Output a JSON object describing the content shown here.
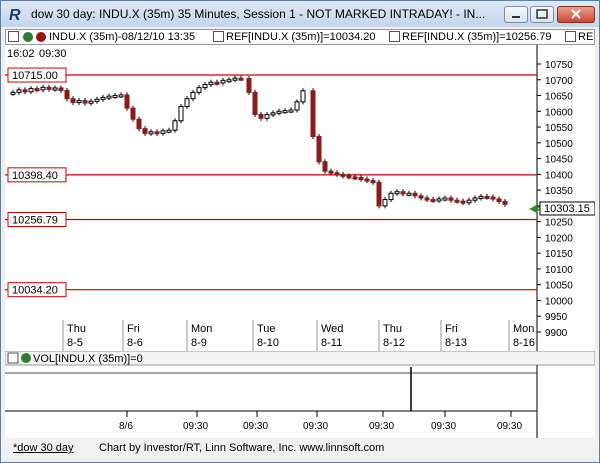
{
  "window": {
    "title": "dow 30 day: INDU.X (35m) 35 Minutes, Session 1 - NOT MARKED INTRADAY! - IN...",
    "minimize": "minimize",
    "maximize": "maximize",
    "close": "close"
  },
  "toolbar": {
    "main_study": "INDU.X (35m)-08/12/10 13:35",
    "ref1": "REF[INDU.X (35m)]=10034.20",
    "ref2": "REF[INDU.X (35m)]=10256.79",
    "ref3": "REF["
  },
  "chart": {
    "time_cursor": "16:02",
    "time_cursor2": "09:30",
    "price_marker": "10303.15",
    "ref_lines": [
      {
        "label": "10715.00",
        "value": 10715.0
      },
      {
        "label": "10398.40",
        "value": 10398.4
      },
      {
        "label": "10256.79",
        "value": 10256.79
      },
      {
        "label": "10034.20",
        "value": 10034.2
      }
    ],
    "y_ticks": [
      "10750",
      "10700",
      "10650",
      "10600",
      "10550",
      "10500",
      "10450",
      "10400",
      "10350",
      "10300",
      "10250",
      "10200",
      "10150",
      "10100",
      "10050",
      "10000",
      "9950",
      "9900"
    ],
    "day_labels": [
      {
        "dow": "Thu",
        "date": "8-5"
      },
      {
        "dow": "Fri",
        "date": "8-6"
      },
      {
        "dow": "Mon",
        "date": "8-9"
      },
      {
        "dow": "Tue",
        "date": "8-10"
      },
      {
        "dow": "Wed",
        "date": "8-11"
      },
      {
        "dow": "Thu",
        "date": "8-12"
      },
      {
        "dow": "Fri",
        "date": "8-13"
      },
      {
        "dow": "Mon",
        "date": "8-16"
      }
    ],
    "colors": {
      "ref_line": "#cc0000",
      "down_candle": "#8b1a1a",
      "up_candle": "#000000",
      "marker": "#2e8b2e"
    }
  },
  "volume": {
    "label": "VOL[INDU.X (35m)]=0",
    "x_labels": [
      "8/6",
      "09:30",
      "09:30",
      "09:30",
      "09:30",
      "09:30",
      "09:30"
    ]
  },
  "status": {
    "tab": "*dow 30 day",
    "credit": "Chart by Investor/RT, Linn Software, Inc. www.linnsoft.com"
  }
}
